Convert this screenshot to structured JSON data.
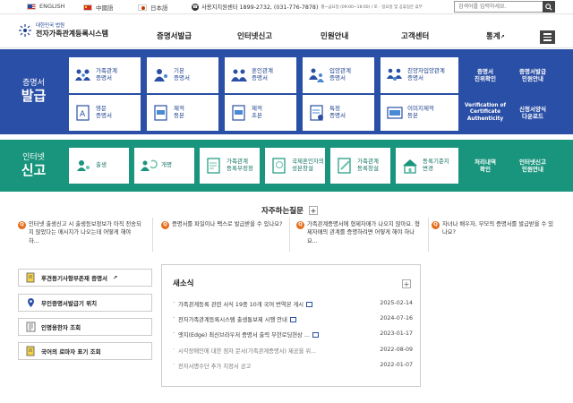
{
  "topbar": {
    "languages": [
      {
        "label": "ENGLISH",
        "flag": "us"
      },
      {
        "label": "中國語",
        "flag": "cn"
      },
      {
        "label": "日本語",
        "flag": "jp"
      }
    ],
    "helpdesk_label": "사용지지원센터 1899-2732, (031-776-7878)",
    "helpdesk_hours": "평~금요일 (09:00~18:00) / 토 · 일요일 및 공휴일은 휴무",
    "search_placeholder": "검색어를 입력하세요."
  },
  "header": {
    "logo_sub": "대한민국 법원",
    "logo_title": "전자가족관계등록시스템",
    "nav": [
      "증명서발급",
      "인터넷신고",
      "민원안내",
      "고객센터",
      "통계"
    ]
  },
  "cert_section": {
    "title_small": "증명서",
    "title_big": "발급",
    "tiles_row1": [
      {
        "line1": "가족관계",
        "line2": "증명서"
      },
      {
        "line1": "기본",
        "line2": "증명서"
      },
      {
        "line1": "혼인관계",
        "line2": "증명서"
      },
      {
        "line1": "입양관계",
        "line2": "증명서"
      },
      {
        "line1": "친양자입양관계",
        "line2": "증명서"
      }
    ],
    "tiles_row2": [
      {
        "line1": "영문",
        "line2": "증명서"
      },
      {
        "line1": "제적",
        "line2": "등본"
      },
      {
        "line1": "제적",
        "line2": "초본"
      },
      {
        "line1": "특정",
        "line2": "증명서"
      },
      {
        "line1": "이미지제적",
        "line2": "등본"
      }
    ],
    "side": [
      {
        "line1": "증명서",
        "line2": "진위확인"
      },
      {
        "line1": "증명서발급",
        "line2": "민원안내"
      },
      {
        "line1": "Verification of",
        "line2": "Certificate Authenticity"
      },
      {
        "line1": "신청서양식",
        "line2": "다운로드"
      }
    ]
  },
  "report_section": {
    "title_small": "인터넷",
    "title_big": "신고",
    "tiles": [
      {
        "line1": "출생",
        "line2": ""
      },
      {
        "line1": "개명",
        "line2": ""
      },
      {
        "line1": "가족관계",
        "line2": "등록부정정"
      },
      {
        "line1": "국제혼인자의",
        "line2": "성본창설"
      },
      {
        "line1": "가족관계",
        "line2": "등록창설"
      },
      {
        "line1": "등록기준지",
        "line2": "변경"
      }
    ],
    "side": [
      {
        "line1": "처리내역",
        "line2": "확인"
      },
      {
        "line1": "인터넷신고",
        "line2": "민원안내"
      }
    ]
  },
  "faq": {
    "title": "자주하는질문",
    "items": [
      "인터넷 출생신고 시 출생등보정보가 아직 전송되지 않았다는 메시지가 나오는데 어떻게 해야 하...",
      "증명서를 파일이나 팩스로 발급받을 수 있나요?",
      "가족관계증명서에 형제자매가 나오지 않아요. 형제자매의 관계를 증명하려면 어떻게 해야 하나요...",
      "자녀나 배우자, 부모의 증명서를 발급받을 수 있나요?"
    ]
  },
  "quick_links": [
    {
      "label": "후견등기사항부존재 증명서",
      "external": true
    },
    {
      "label": "무인증명서발급기 위치",
      "external": false
    },
    {
      "label": "인명용한자 조회",
      "external": false
    },
    {
      "label": "국어의 로마자 표기 조회",
      "external": false
    }
  ],
  "news": {
    "title": "새소식",
    "items": [
      {
        "title": "가족관계등록 관련 서식 19종 10개 국어 번역본 게시",
        "date": "2025-02-14",
        "new": true
      },
      {
        "title": "전자가족관계등록시스템 출생통보제 시행 안내",
        "date": "2024-07-16",
        "new": true
      },
      {
        "title": "엣지(Edge) 최신브라우저 증명서 출력 무한로딩현상 ...",
        "date": "2023-01-17",
        "new": true
      },
      {
        "title": "시각장애인에 대한 점자 문서(가족관계증명서) 제공을 위...",
        "date": "2022-08-09",
        "new": false
      },
      {
        "title": "전자서명수단 추가 지정서 공고",
        "date": "2022-01-07",
        "new": false
      }
    ]
  },
  "colors": {
    "cert_blue": "#2a4fa6",
    "report_green": "#19957d",
    "faq_orange": "#e46e1e"
  }
}
